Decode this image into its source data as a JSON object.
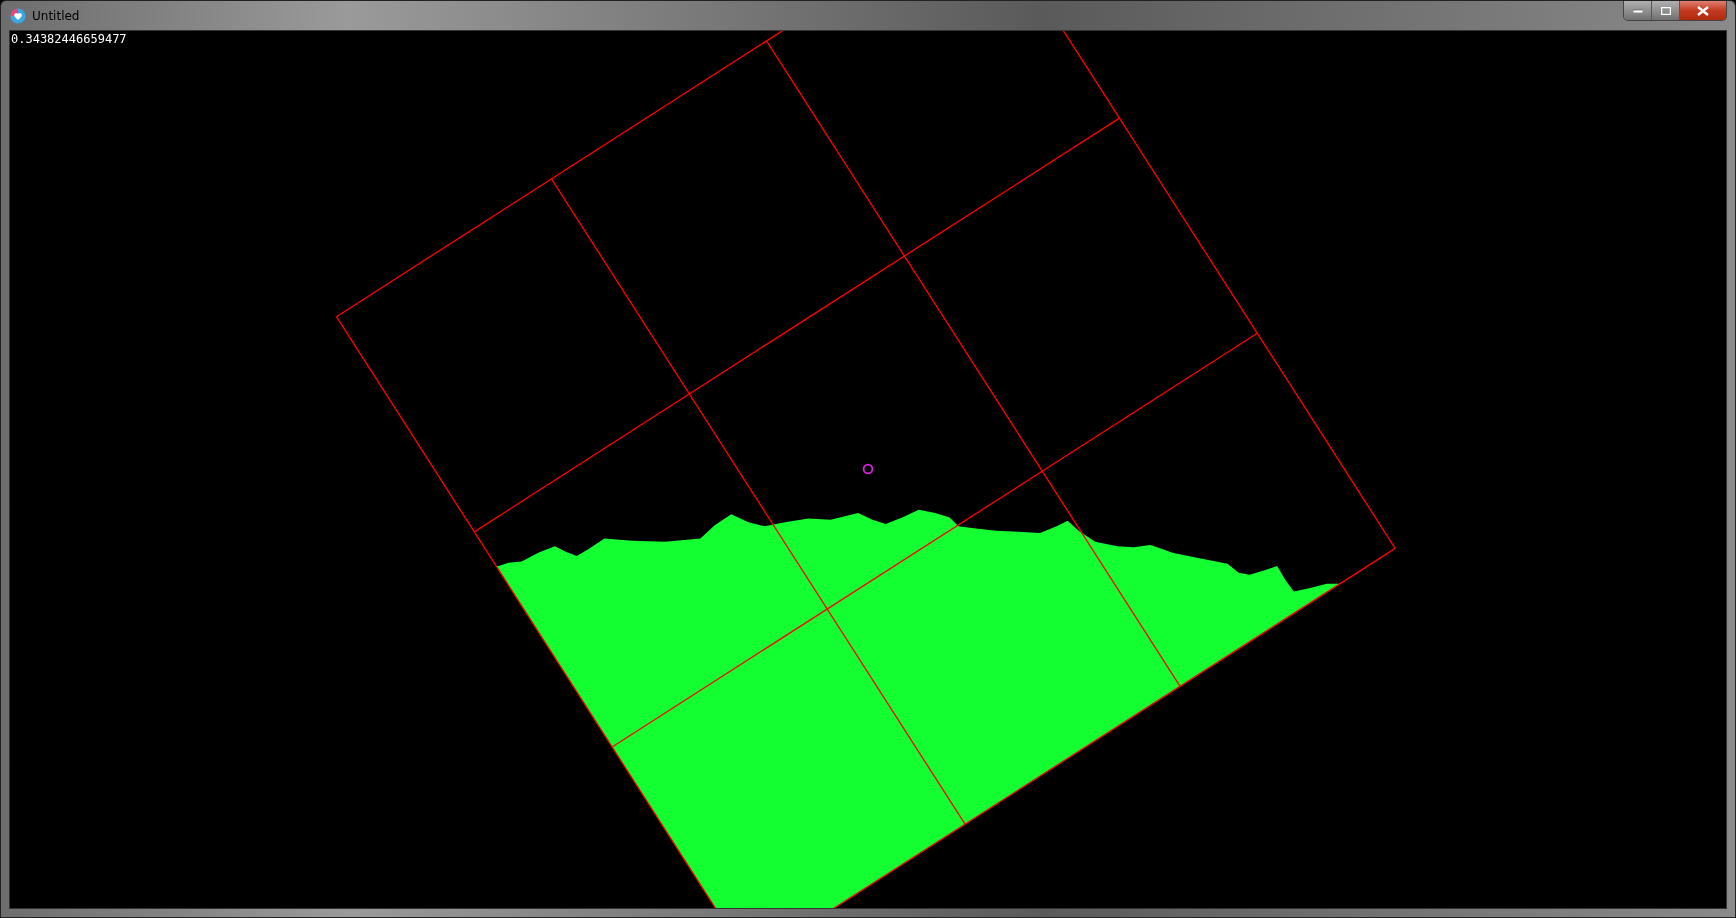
{
  "window": {
    "title": "Untitled"
  },
  "readout": "0.34382446659477"
}
